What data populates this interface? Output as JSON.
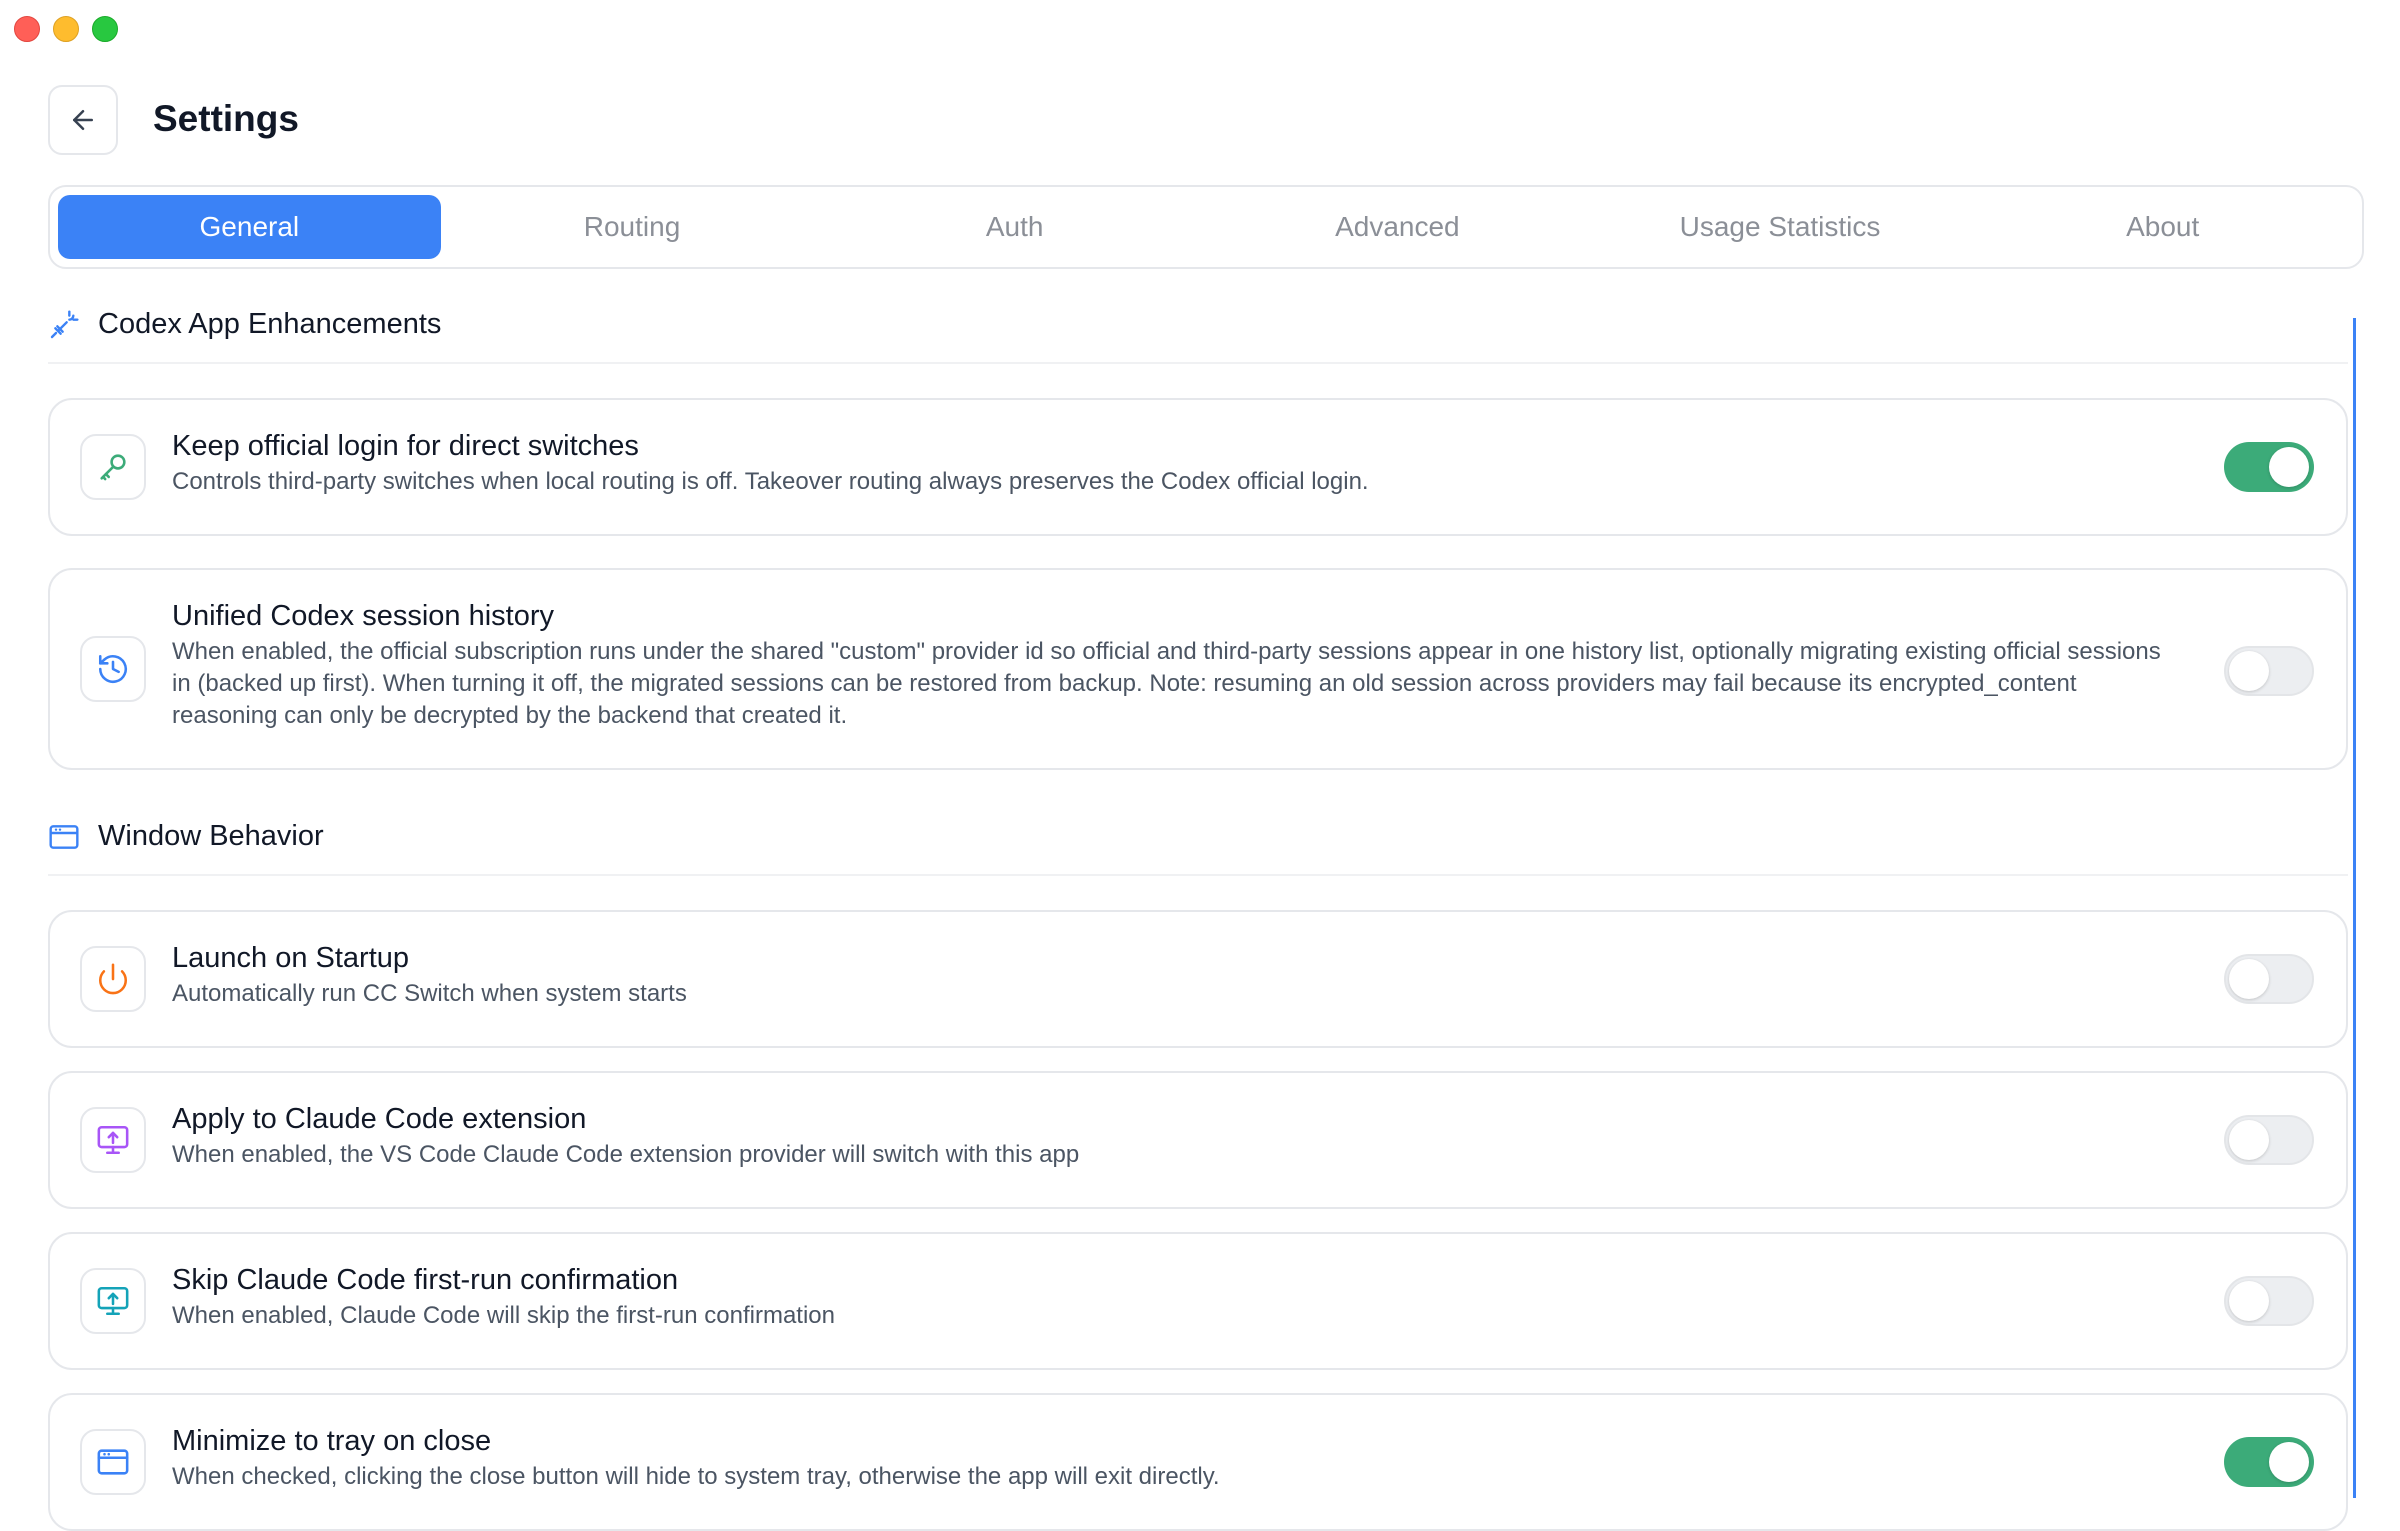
{
  "window": {
    "title": "Settings",
    "back_label": "back"
  },
  "tabs": [
    {
      "label": "General",
      "active": true
    },
    {
      "label": "Routing",
      "active": false
    },
    {
      "label": "Auth",
      "active": false
    },
    {
      "label": "Advanced",
      "active": false
    },
    {
      "label": "Usage Statistics",
      "active": false
    },
    {
      "label": "About",
      "active": false
    }
  ],
  "sections": {
    "codex": {
      "title": "Codex App Enhancements",
      "icon": "wrench-plug-icon",
      "items": [
        {
          "title": "Keep official login for direct switches",
          "description": "Controls third-party switches when local routing is off. Takeover routing always preserves the Codex official login.",
          "icon": "key-icon",
          "enabled": true
        },
        {
          "title": "Unified Codex session history",
          "description": "When enabled, the official subscription runs under the shared \"custom\" provider id so official and third-party sessions appear in one history list, optionally migrating existing official sessions in (backed up first). When turning it off, the migrated sessions can be restored from backup. Note: resuming an old session across providers may fail because its encrypted_content reasoning can only be decrypted by the backend that created it.",
          "icon": "history-icon",
          "enabled": false
        }
      ]
    },
    "window": {
      "title": "Window Behavior",
      "icon": "app-window-icon",
      "items": [
        {
          "title": "Launch on Startup",
          "description": "Automatically run CC Switch when system starts",
          "icon": "power-icon",
          "enabled": false
        },
        {
          "title": "Apply to Claude Code extension",
          "description": "When enabled, the VS Code Claude Code extension provider will switch with this app",
          "icon": "monitor-upload-icon",
          "enabled": false
        },
        {
          "title": "Skip Claude Code first-run confirmation",
          "description": "When enabled, Claude Code will skip the first-run confirmation",
          "icon": "monitor-upload-icon",
          "enabled": false
        },
        {
          "title": "Minimize to tray on close",
          "description": "When checked, clicking the close button will hide to system tray, otherwise the app will exit directly.",
          "icon": "app-window-icon",
          "enabled": true
        }
      ]
    }
  },
  "colors": {
    "accent": "#3b82f6",
    "toggle_on": "#3cab79",
    "toggle_off": "#eceef1",
    "key_icon": "#3cab79",
    "history_icon": "#3b82f6",
    "power_icon": "#f97316",
    "extension_icon": "#a855f7",
    "skip_icon": "#14a3b8"
  }
}
